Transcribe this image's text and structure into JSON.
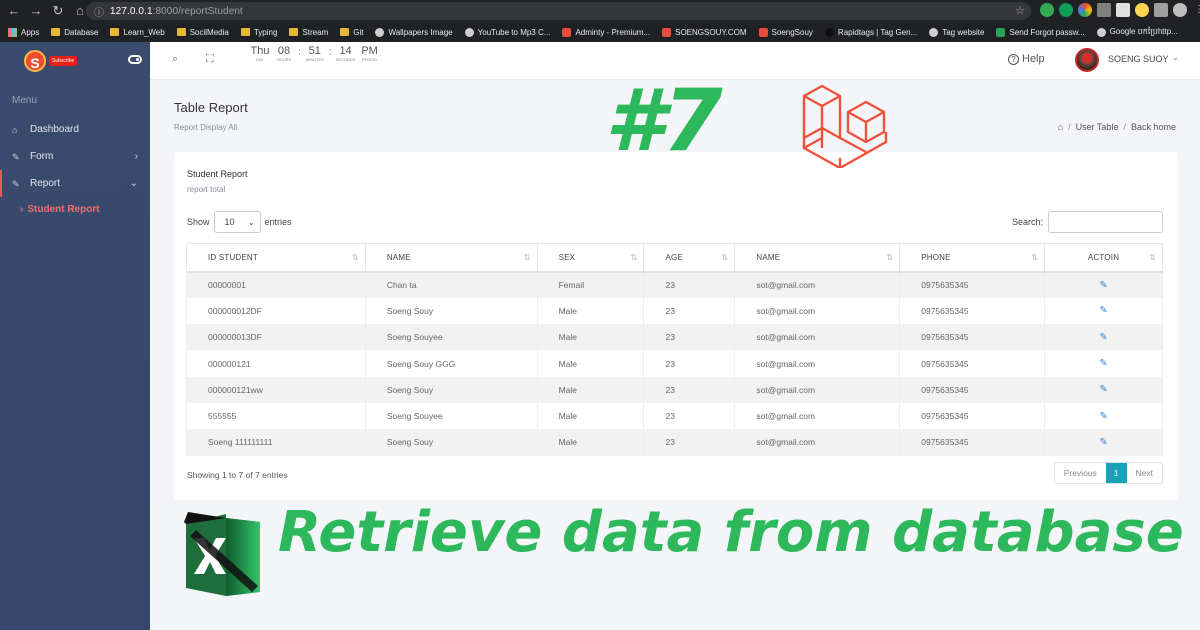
{
  "browser": {
    "url_host": "127.0.0.1",
    "url_path": ":8000/reportStudent",
    "bookmarks": [
      "Apps",
      "Database",
      "Learn_Web",
      "SocilMedia",
      "Typing",
      "Stream",
      "Git",
      "Wallpapers Image",
      "YouTube to Mp3 C...",
      "Adminty - Premium...",
      "SOENGSOUY.COM",
      "SoengSouy",
      "Rapidtags | Tag Gen...",
      "Tag website",
      "Send Forgot passw...",
      "Google បកប្រែhttp..."
    ]
  },
  "sidebar": {
    "section": "Menu",
    "items": [
      {
        "label": "Dashboard"
      },
      {
        "label": "Form"
      },
      {
        "label": "Report"
      }
    ],
    "sub_item": "Student Report",
    "brand_badge": "Subscribe"
  },
  "topbar": {
    "clock": {
      "day": "Thu",
      "day_l": "Day",
      "hours": "08",
      "hours_l": "Hours",
      "minutes": "51",
      "minutes_l": "Minutes",
      "seconds": "14",
      "seconds_l": "Seconds",
      "period": "PM",
      "period_l": "Period"
    },
    "help": "Help",
    "user": "SOENG SUOY"
  },
  "page": {
    "title": "Table Report",
    "subtitle": "Report Display All",
    "breadcrumb": [
      "User Table",
      "Back home"
    ]
  },
  "card": {
    "title": "Student Report",
    "subtitle": "report total",
    "show_label": "Show",
    "entries_value": "10",
    "entries_label": "entries",
    "search_label": "Search:",
    "columns": [
      "ID STUDENT",
      "NAME",
      "SEX",
      "AGE",
      "NAME",
      "PHONE",
      "ACTOIN"
    ],
    "rows": [
      [
        "00000001",
        "Chan ta",
        "Femail",
        "23",
        "sot@gmail.com",
        "0975635345"
      ],
      [
        "000000012DF",
        "Soeng Souy",
        "Male",
        "23",
        "sot@gmail.com",
        "0975635345"
      ],
      [
        "000000013DF",
        "Soeng Souyee",
        "Male",
        "23",
        "sot@gmail.com",
        "0975635345"
      ],
      [
        "000000121",
        "Soeng Souy GGG",
        "Male",
        "23",
        "sot@gmail.com",
        "0975635345"
      ],
      [
        "000000121ww",
        "Soeng Souy",
        "Male",
        "23",
        "sot@gmail.com",
        "0975635345"
      ],
      [
        "555555",
        "Soeng Souyee",
        "Male",
        "23",
        "sot@gmail.com",
        "0975635345"
      ],
      [
        "Soeng 111111111",
        "Soeng Souy",
        "Male",
        "23",
        "sot@gmail.com",
        "0975635345"
      ]
    ],
    "info": "Showing 1 to 7 of 7 entries",
    "pager": {
      "prev": "Previous",
      "current": "1",
      "next": "Next"
    }
  },
  "overlay": {
    "episode": "#7",
    "headline": "Retrieve data from database",
    "accent": "#2eb85c",
    "laravel_color": "#f0513c"
  }
}
